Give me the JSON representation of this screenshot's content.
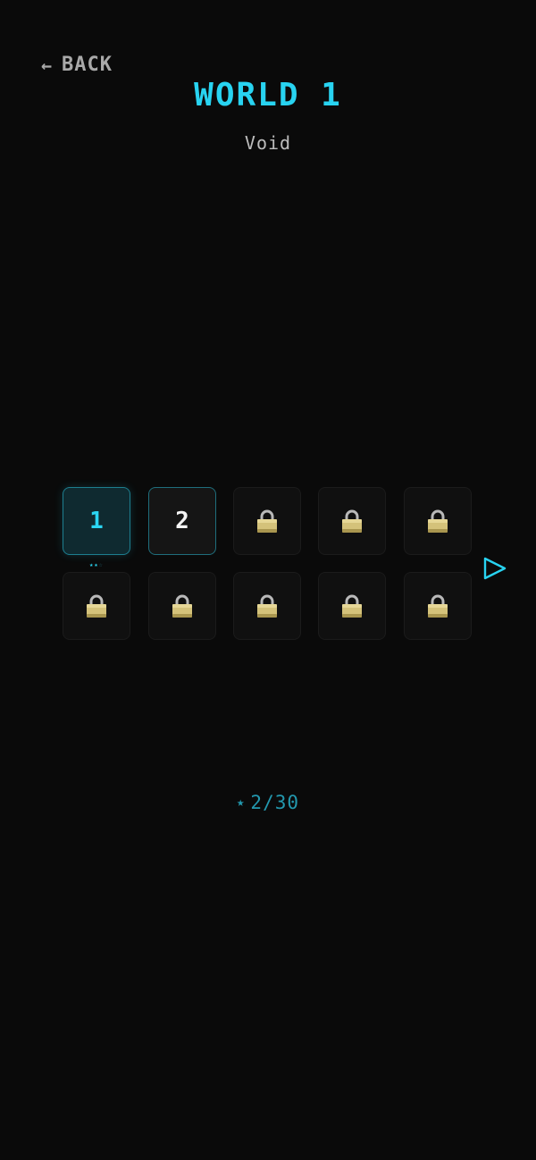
{
  "header": {
    "back_arrow": "←",
    "back_label": "BACK",
    "title": "WORLD 1",
    "subtitle": "Void"
  },
  "levels": [
    {
      "label": "1",
      "state": "completed",
      "stars": 2,
      "max_stars": 3
    },
    {
      "label": "2",
      "state": "available"
    },
    {
      "label": "",
      "state": "locked"
    },
    {
      "label": "",
      "state": "locked"
    },
    {
      "label": "",
      "state": "locked"
    },
    {
      "label": "",
      "state": "locked"
    },
    {
      "label": "",
      "state": "locked"
    },
    {
      "label": "",
      "state": "locked"
    },
    {
      "label": "",
      "state": "locked"
    },
    {
      "label": "",
      "state": "locked"
    }
  ],
  "footer": {
    "star_icon": "★",
    "star_count": "2/30"
  },
  "colors": {
    "background": "#0a0a0a",
    "accent": "#28d3f1",
    "lock_gold": "#d4c27a"
  },
  "icons": {
    "back": "left-arrow-icon",
    "lock": "padlock-icon",
    "next": "play-triangle-icon",
    "star": "star-icon"
  }
}
